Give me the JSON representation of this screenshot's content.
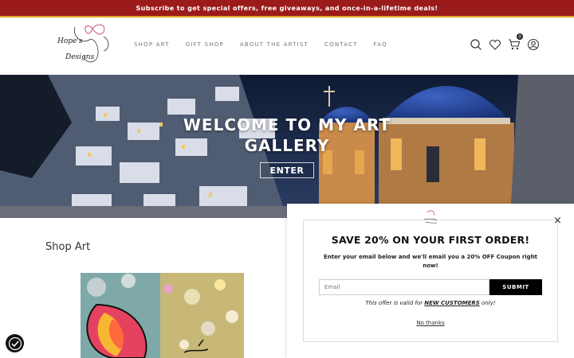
{
  "announcement": "Subscribe to get special offers, free giveaways, and once-in-a-lifetime deals!",
  "brand": {
    "line1": "Hope's",
    "line2": "Designs"
  },
  "nav": [
    "SHOP ART",
    "GIFT SHOP",
    "ABOUT THE ARTIST",
    "CONTACT",
    "FAQ"
  ],
  "header_icons": {
    "search": "search-icon",
    "wishlist": "heart-icon",
    "cart": "cart-icon",
    "account": "user-icon",
    "cart_count": "0"
  },
  "hero": {
    "title": "WELCOME TO MY ART GALLERY",
    "button": "ENTER"
  },
  "section_title": "Shop Art",
  "popup": {
    "heading": "SAVE 20% ON YOUR FIRST ORDER!",
    "text": "Enter your email below and we'll email you a 20% OFF Coupon right now!",
    "email_placeholder": "Email",
    "submit": "SUBMIT",
    "offer_prefix": "This offer is valid for ",
    "offer_bold": "NEW CUSTOMERS",
    "offer_suffix": " only!",
    "no_thanks": "No thanks",
    "close": "×"
  },
  "colors": {
    "announcement_bg": "#9b1b1b",
    "announcement_border": "#e0a52a",
    "button": "#000000"
  }
}
